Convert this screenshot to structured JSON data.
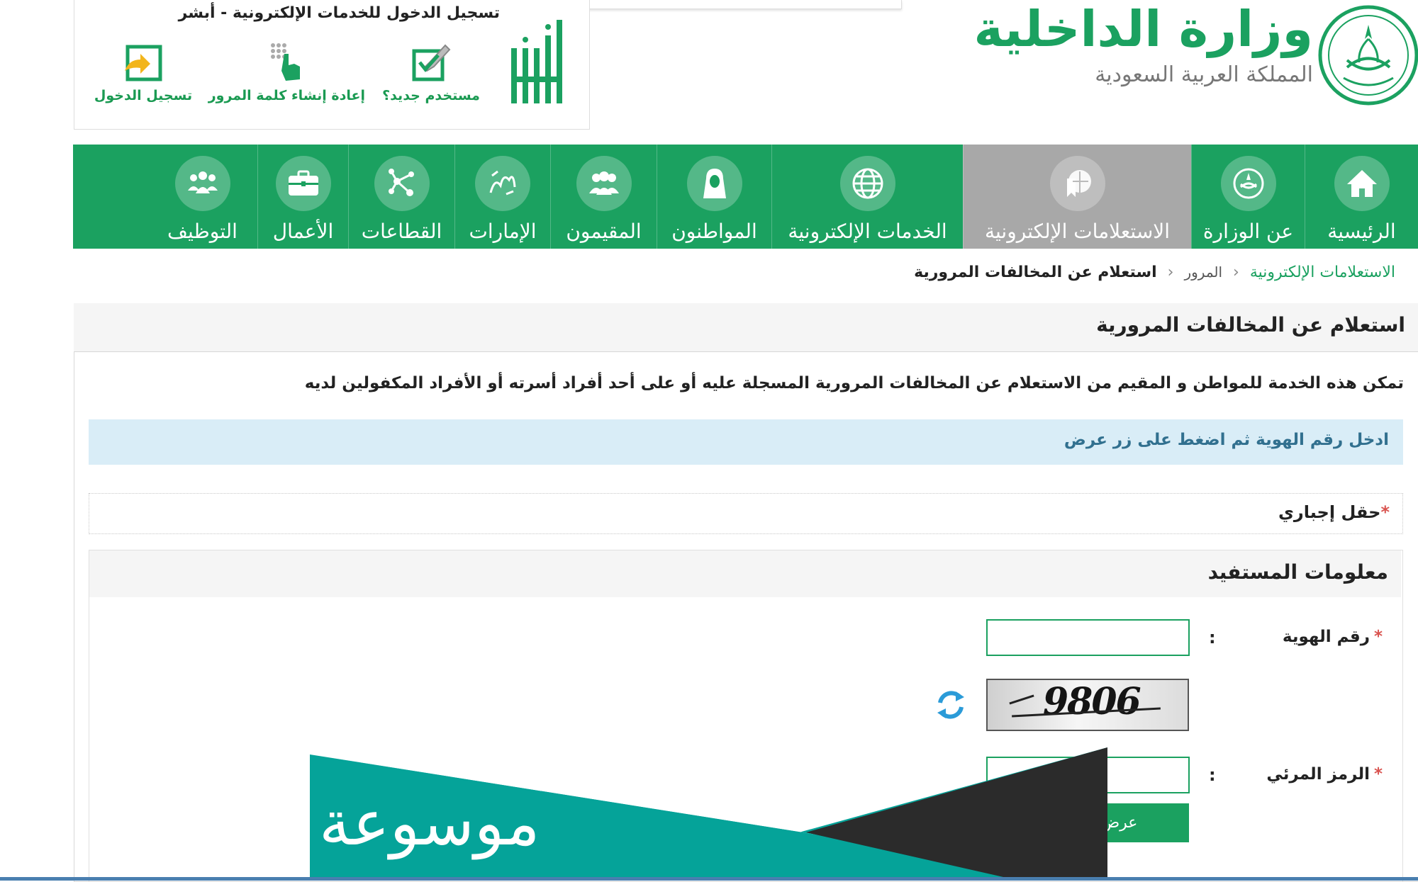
{
  "header": {
    "ministry_name": "وزارة الداخلية",
    "ministry_sub": "المملكة العربية السعودية"
  },
  "login_box": {
    "title": "تسجيل الدخول للخدمات الإلكترونية - أبشر",
    "links": [
      {
        "label": "مستخدم جديد؟",
        "icon": "new-user-icon"
      },
      {
        "label": "إعادة إنشاء كلمة المرور",
        "icon": "reset-password-icon"
      },
      {
        "label": "تسجيل الدخول",
        "icon": "login-icon"
      }
    ]
  },
  "nav": {
    "items": [
      {
        "label": "الرئيسية",
        "icon": "home-icon"
      },
      {
        "label": "عن الوزارة",
        "icon": "emblem-icon"
      },
      {
        "label": "الاستعلامات الإلكترونية",
        "icon": "inquiry-icon",
        "active": true
      },
      {
        "label": "الخدمات الإلكترونية",
        "icon": "globe-icon"
      },
      {
        "label": "المواطنون",
        "icon": "citizen-icon"
      },
      {
        "label": "المقيمون",
        "icon": "residents-icon"
      },
      {
        "label": "الإمارات",
        "icon": "emirates-icon"
      },
      {
        "label": "القطاعات",
        "icon": "sectors-icon"
      },
      {
        "label": "الأعمال",
        "icon": "briefcase-icon"
      },
      {
        "label": "التوظيف",
        "icon": "employment-icon"
      }
    ]
  },
  "breadcrumb": {
    "root": "الاستعلامات الإلكترونية",
    "middle": "المرور",
    "current": "استعلام عن المخالفات المرورية",
    "separator": "‹"
  },
  "panel": {
    "title": "استعلام عن المخالفات المرورية",
    "description": "تمكن هذه الخدمة للمواطن و المقيم من الاستعلام عن المخالفات المرورية المسجلة عليه أو على أحد أفراد أسرته أو الأفراد المكفولين لديه",
    "info": "ادخل رقم الهوية ثم اضغط على زر عرض",
    "required_note": "حقل إجباري",
    "required_star": "*"
  },
  "beneficiary": {
    "title": "معلومات المستفيد",
    "id_label": "رقم الهوية",
    "id_value": "",
    "captcha_label": "الرمز المرئي",
    "captcha_value": "",
    "captcha_image_text": "9806",
    "colon": ":",
    "star": "*",
    "submit_label": "عرض"
  },
  "watermark": {
    "text": "موسوعة"
  },
  "colors": {
    "brand_green": "#1ba160",
    "active_tab": "#a8a8a8",
    "info_bg": "#d9edf7",
    "banner_teal": "#05a399",
    "banner_dark": "#2b2b2b"
  }
}
